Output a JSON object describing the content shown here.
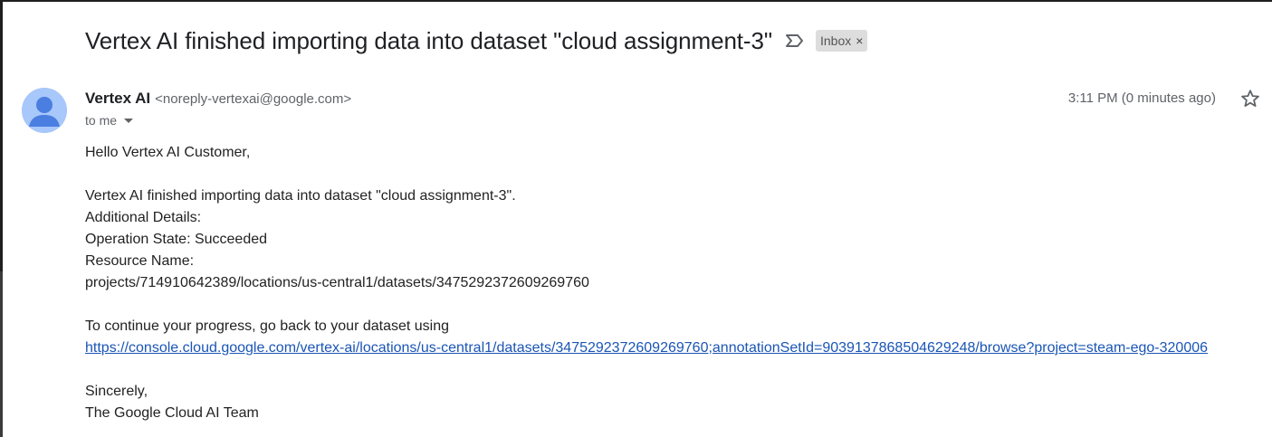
{
  "email": {
    "subject": "Vertex AI finished importing data into dataset \"cloud assignment-3\"",
    "label_chip": "Inbox",
    "label_chip_close": "×",
    "sender_name": "Vertex AI",
    "sender_email": "<noreply-vertexai@google.com>",
    "recipient": "to me",
    "timestamp": "3:11 PM (0 minutes ago)",
    "body": {
      "greeting": "Hello Vertex AI Customer,",
      "line1": "Vertex AI finished importing data into dataset \"cloud assignment-3\".",
      "line2": "Additional Details:",
      "line3": "Operation State: Succeeded",
      "line4": "Resource Name:",
      "line5": "projects/714910642389/locations/us-central1/datasets/3475292372609269760",
      "line6": "To continue your progress, go back to your dataset using",
      "link": "https://console.cloud.google.com/vertex-ai/locations/us-central1/datasets/3475292372609269760;annotationSetId=9039137868504629248/browse?project=steam-ego-320006",
      "closing": "Sincerely,",
      "signature": "The Google Cloud AI Team"
    }
  },
  "icons": {
    "important": "important-marker-icon",
    "star": "star-icon",
    "avatar": "avatar-icon",
    "dropdown": "chevron-down-icon"
  },
  "colors": {
    "link": "#1a55b5",
    "avatar_bg": "#a8c7fa",
    "avatar_fg": "#4a7ee0",
    "chip_bg": "#dddddd"
  }
}
